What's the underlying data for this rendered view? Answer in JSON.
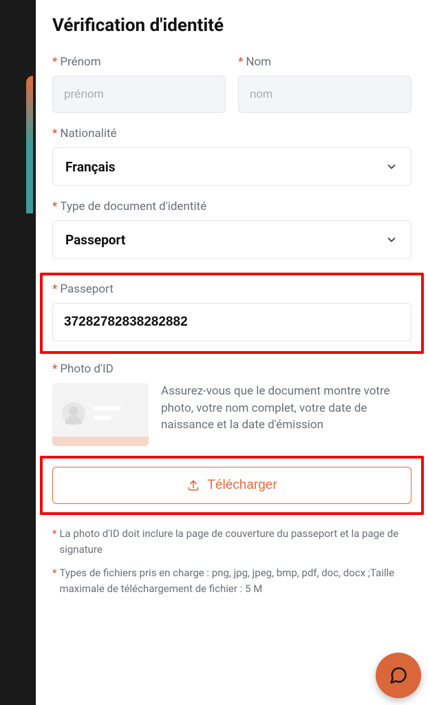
{
  "title": "Vérification d'identité",
  "firstName": {
    "label": "Prénom",
    "placeholder": "prénom",
    "value": ""
  },
  "lastName": {
    "label": "Nom",
    "placeholder": "nom",
    "value": ""
  },
  "nationality": {
    "label": "Nationalité",
    "selected": "Français"
  },
  "docType": {
    "label": "Type de document d'identité",
    "selected": "Passeport"
  },
  "passport": {
    "label": "Passeport",
    "value": "37282782838282882"
  },
  "photo": {
    "label": "Photo d'ID",
    "hint": "Assurez-vous que le document montre votre photo, votre nom complet, votre date de naissance et la date d'émission"
  },
  "uploadLabel": "Télécharger",
  "notes": [
    "La photo d'ID doit inclure la page de couverture du passeport et la page de signature",
    "Types de fichiers pris en charge : png, jpg, jpeg, bmp, pdf, doc, docx ;Taille maximale de téléchargement de fichier : 5 M"
  ]
}
